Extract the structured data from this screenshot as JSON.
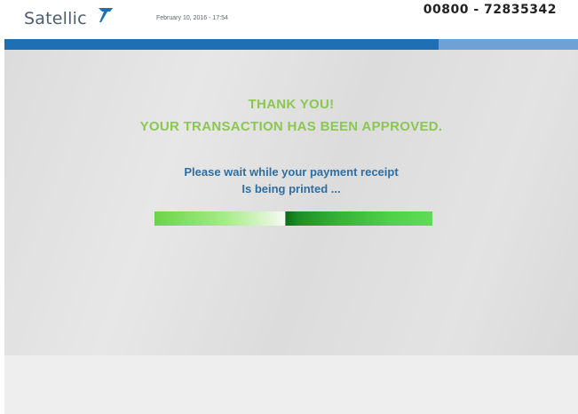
{
  "header": {
    "logo_text": "Satellic",
    "datetime": "February 10, 2016 - 17:54",
    "phone": "00800 - 72835342"
  },
  "message": {
    "thanks": "THANK YOU!",
    "approved": "YOUR TRANSACTION HAS BEEN APPROVED.",
    "wait_line_1": "Please wait while your payment receipt",
    "wait_line_2": "Is being printed ..."
  },
  "colors": {
    "brand_blue": "#1f6fb5",
    "light_blue": "#6fa1d4",
    "success_green": "#8cc653",
    "info_blue": "#2d6fa3"
  },
  "icons": {
    "logo_mark": "satellite-arrow-icon"
  }
}
